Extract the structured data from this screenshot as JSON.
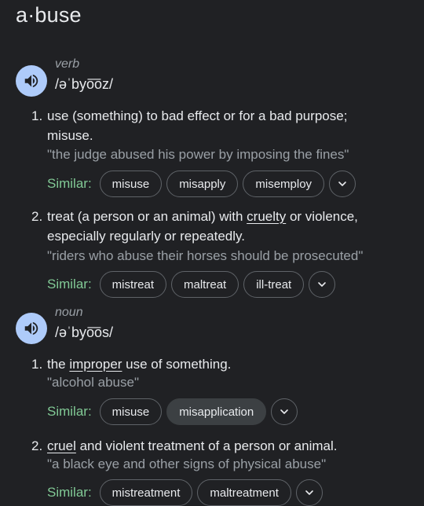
{
  "headword": "a·buse",
  "entries": [
    {
      "pos": "verb",
      "pronunciation": "/əˈbyo͞oz/",
      "speaker_icon": "volume-icon",
      "senses": [
        {
          "num": "1.",
          "def_line1": "use (something) to bad effect or for a bad purpose;",
          "def_line2": "misuse.",
          "example": "\"the judge abused his power by imposing the fines\"",
          "similar_label": "Similar:",
          "similar": [
            "misuse",
            "misapply",
            "misemploy"
          ]
        },
        {
          "num": "2.",
          "def_pre": "treat (a person or an animal) with ",
          "def_link": "cruelty",
          "def_post": " or violence,",
          "def_line2": "especially regularly or repeatedly.",
          "example": "\"riders who abuse their horses should be prosecuted\"",
          "similar_label": "Similar:",
          "similar": [
            "mistreat",
            "maltreat",
            "ill-treat"
          ]
        }
      ]
    },
    {
      "pos": "noun",
      "pronunciation": "/əˈbyo͞os/",
      "speaker_icon": "volume-icon",
      "senses": [
        {
          "num": "1.",
          "def_pre": "the ",
          "def_link": "improper",
          "def_post": " use of something.",
          "example": "\"alcohol abuse\"",
          "similar_label": "Similar:",
          "similar": [
            "misuse",
            "misapplication"
          ]
        },
        {
          "num": "2.",
          "def_link": "cruel",
          "def_post": " and violent treatment of a person or animal.",
          "example": "\"a black eye and other signs of physical abuse\"",
          "similar_label": "Similar:",
          "similar": [
            "mistreatment",
            "maltreatment"
          ]
        }
      ]
    }
  ],
  "colors": {
    "background": "#202124",
    "text": "#e8eaed",
    "muted": "#9aa0a6",
    "similar_label": "#81c995",
    "speaker_bg": "#aecbfa",
    "chip_border": "#5f6368"
  }
}
